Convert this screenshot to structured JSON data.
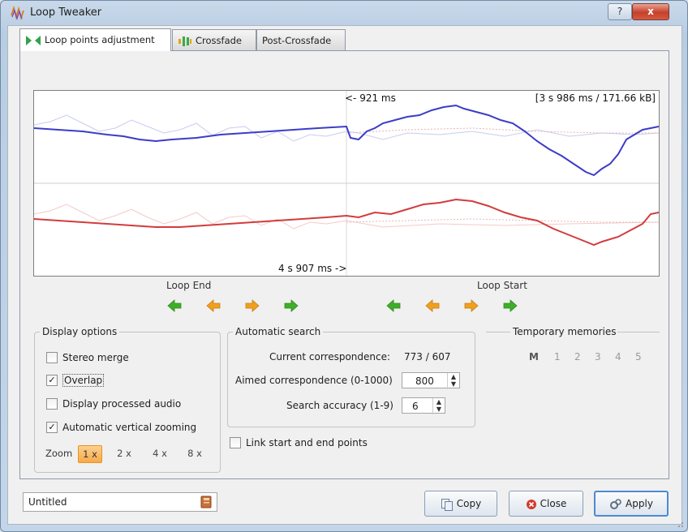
{
  "window": {
    "title": "Loop Tweaker",
    "help_label": "?",
    "close_label": "x"
  },
  "tabs": [
    {
      "label": "Loop points adjustment",
      "active": true
    },
    {
      "label": "Crossfade",
      "active": false
    },
    {
      "label": "Post-Crossfade",
      "active": false
    }
  ],
  "waveform": {
    "top_center_label": "<- 921 ms",
    "top_right_label": "[3 s 986 ms / 171.66 kB]",
    "bottom_center_label": "4 s 907 ms ->",
    "colors": {
      "left_channel": "#3c3cc8",
      "right_channel": "#d23c3c"
    }
  },
  "loop_end": {
    "label": "Loop End"
  },
  "loop_start": {
    "label": "Loop Start"
  },
  "display_options": {
    "title": "Display options",
    "stereo_merge": {
      "label": "Stereo merge",
      "checked": false
    },
    "overlap": {
      "label": "Overlap",
      "checked": true
    },
    "display_processed": {
      "label": "Display processed audio",
      "checked": false
    },
    "auto_vertical_zoom": {
      "label": "Automatic vertical zooming",
      "checked": true
    },
    "zoom_label": "Zoom",
    "zoom_options": [
      "1 x",
      "2 x",
      "4 x",
      "8 x"
    ],
    "zoom_selected": "1 x",
    "check_mark": "✓"
  },
  "automatic_search": {
    "title": "Automatic search",
    "current_label": "Current correspondence:",
    "current_value": "773 / 607",
    "aimed_label": "Aimed correspondence (0-1000)",
    "aimed_value": "800",
    "accuracy_label": "Search accuracy (1-9)",
    "accuracy_value": "6",
    "spin_up": "▲",
    "spin_down": "▼"
  },
  "link_points": {
    "label": "Link start and end points",
    "checked": false
  },
  "temporary_memories": {
    "title": "Temporary memories",
    "items": [
      "M",
      "1",
      "2",
      "3",
      "4",
      "5"
    ]
  },
  "footer": {
    "name_value": "Untitled",
    "copy_label": "Copy",
    "close_label": "Close",
    "apply_label": "Apply"
  },
  "colors": {
    "accent": "#4d8ad3",
    "arrow_green": "#3fae2a",
    "arrow_orange": "#f0a020",
    "zoom_selected": "#f7a94a"
  }
}
